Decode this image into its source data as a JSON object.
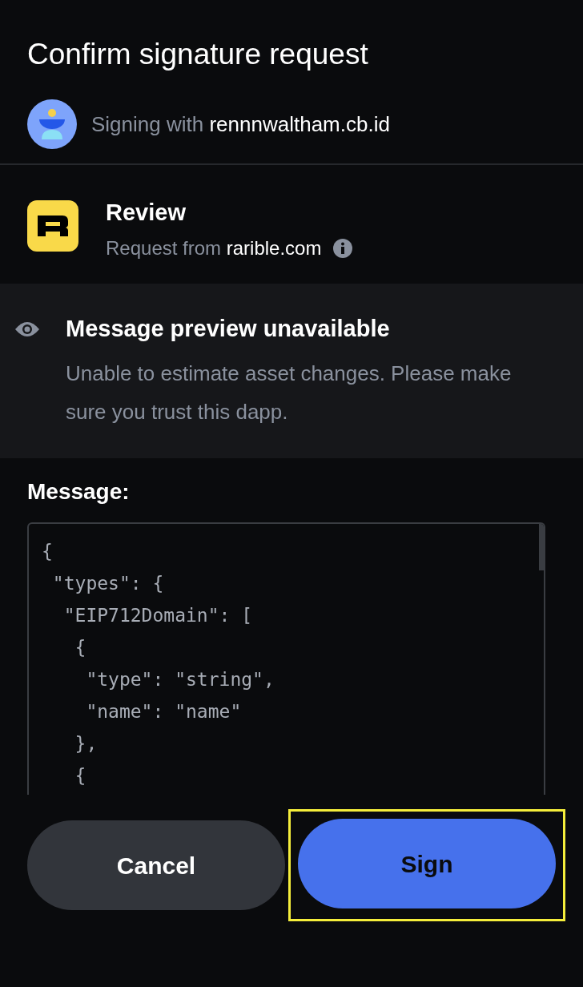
{
  "title": "Confirm signature request",
  "signer": {
    "prefix": "Signing with",
    "account": "rennnwaltham.cb.id"
  },
  "review": {
    "title": "Review",
    "prefix": "Request from",
    "origin": "rarible.com"
  },
  "preview": {
    "title": "Message preview unavailable",
    "body": "Unable to estimate asset changes. Please make sure you trust this dapp."
  },
  "message": {
    "label": "Message:",
    "lines": [
      "{",
      " \"types\": {",
      "  \"EIP712Domain\": [",
      "   {",
      "    \"type\": \"string\",",
      "    \"name\": \"name\"",
      "   },",
      "   {"
    ]
  },
  "actions": [
    {
      "label": "Cancel",
      "kind": "secondary",
      "highlighted": false
    },
    {
      "label": "Sign",
      "kind": "primary",
      "highlighted": true
    }
  ]
}
